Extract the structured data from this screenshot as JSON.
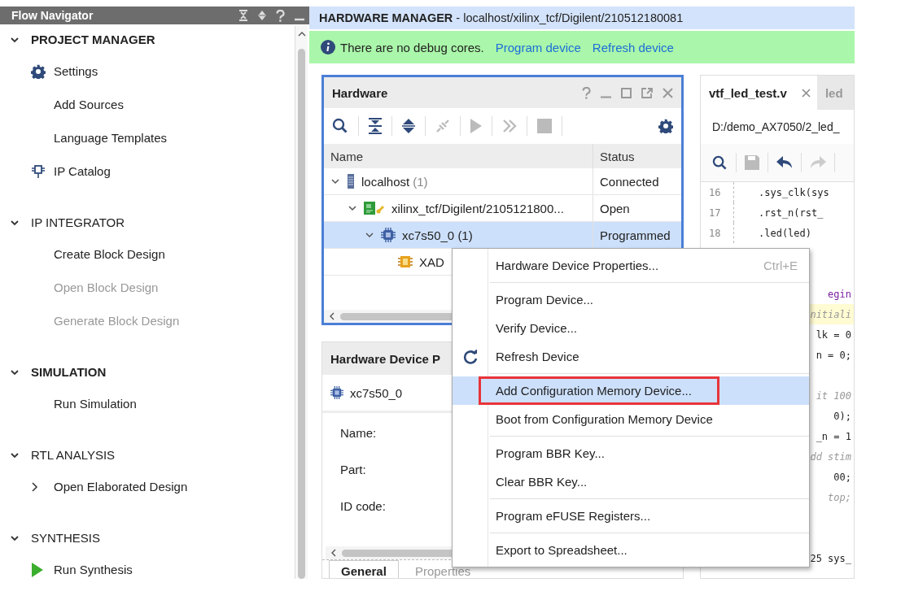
{
  "flow_navigator": {
    "title": "Flow Navigator",
    "sections": [
      {
        "title": "PROJECT MANAGER",
        "expanded": true,
        "emphasized": true,
        "items": [
          {
            "label": "Settings",
            "disabled": false
          },
          {
            "label": "Add Sources",
            "disabled": false
          },
          {
            "label": "Language Templates",
            "disabled": false
          },
          {
            "label": "IP Catalog",
            "disabled": false
          }
        ]
      },
      {
        "title": "IP INTEGRATOR",
        "expanded": true,
        "emphasized": false,
        "items": [
          {
            "label": "Create Block Design",
            "disabled": false
          },
          {
            "label": "Open Block Design",
            "disabled": true
          },
          {
            "label": "Generate Block Design",
            "disabled": true
          }
        ]
      },
      {
        "title": "SIMULATION",
        "expanded": true,
        "emphasized": true,
        "items": [
          {
            "label": "Run Simulation",
            "disabled": false
          }
        ]
      },
      {
        "title": "RTL ANALYSIS",
        "expanded": true,
        "emphasized": false,
        "items": [
          {
            "label": "Open Elaborated Design",
            "disabled": false
          }
        ]
      },
      {
        "title": "SYNTHESIS",
        "expanded": true,
        "emphasized": false,
        "items": [
          {
            "label": "Run Synthesis",
            "disabled": false
          }
        ]
      }
    ]
  },
  "hardware_manager": {
    "title": "HARDWARE MANAGER",
    "path": "- localhost/xilinx_tcf/Digilent/210512180081"
  },
  "banner": {
    "message": "There are no debug cores.",
    "links": [
      "Program device",
      "Refresh device"
    ]
  },
  "hardware_panel": {
    "title": "Hardware",
    "columns": [
      "Name",
      "Status"
    ],
    "tree": [
      {
        "name": "localhost",
        "count": "(1)",
        "status": "Connected",
        "expanded": true,
        "selected": false,
        "children": [
          {
            "name": "xilinx_tcf/Digilent/2105121800...",
            "status": "Open",
            "expanded": true,
            "selected": false,
            "children": [
              {
                "name": "xc7s50_0 (1)",
                "status": "Programmed",
                "expanded": true,
                "selected": true,
                "children": [
                  {
                    "name": "XAD",
                    "selected": false
                  }
                ]
              }
            ]
          }
        ]
      }
    ]
  },
  "properties_panel": {
    "title": "Hardware Device P",
    "device": "xc7s50_0",
    "fields": [
      "Name:",
      "Part:",
      "ID code:"
    ],
    "tabs": [
      {
        "label": "General",
        "selected": true
      },
      {
        "label": "Properties",
        "selected": false
      }
    ]
  },
  "editor": {
    "tabs": [
      {
        "label": "vtf_led_test.v",
        "selected": true
      },
      {
        "label": "led",
        "selected": false
      }
    ],
    "path": "D:/demo_AX7050/2_led_",
    "lines": [
      {
        "number": "16",
        "text": ".sys_clk(sys",
        "kind": "code",
        "highlight": false
      },
      {
        "number": "17",
        "text": ".rst_n(rst_",
        "kind": "code",
        "highlight": false
      },
      {
        "number": "18",
        "text": ".led(led)",
        "kind": "code",
        "highlight": false
      },
      {
        "kind": "blank"
      },
      {
        "kind": "blank"
      },
      {
        "text": "egin",
        "kind": "keyword",
        "highlight": false
      },
      {
        "text": "nitiali",
        "kind": "comment",
        "highlight": true
      },
      {
        "text": "lk = 0",
        "kind": "code",
        "highlight": false
      },
      {
        "text": "n = 0;",
        "kind": "code",
        "highlight": false
      },
      {
        "kind": "blank"
      },
      {
        "text": "it 100",
        "kind": "comment",
        "highlight": false
      },
      {
        "text": "0);",
        "kind": "code",
        "highlight": false
      },
      {
        "text": "_n = 1",
        "kind": "code",
        "highlight": false
      },
      {
        "text": "dd stim",
        "kind": "comment",
        "highlight": false
      },
      {
        "text": "00;",
        "kind": "code",
        "highlight": false
      },
      {
        "text": "top;",
        "kind": "comment",
        "highlight": false
      },
      {
        "kind": "blank"
      },
      {
        "kind": "blank"
      },
      {
        "text": "25 sys_",
        "kind": "code",
        "highlight": false
      }
    ]
  },
  "context_menu": {
    "groups": [
      [
        {
          "label": "Hardware Device Properties...",
          "shortcut": "Ctrl+E",
          "selected": false,
          "annotated": false
        }
      ],
      [
        {
          "label": "Program Device...",
          "selected": false,
          "annotated": false
        },
        {
          "label": "Verify Device...",
          "selected": false,
          "annotated": false
        },
        {
          "label": "Refresh Device",
          "selected": false,
          "annotated": false
        }
      ],
      [
        {
          "label": "Add Configuration Memory Device...",
          "selected": true,
          "annotated": true
        },
        {
          "label": "Boot from Configuration Memory Device",
          "selected": false,
          "annotated": false
        }
      ],
      [
        {
          "label": "Program BBR Key...",
          "selected": false,
          "annotated": false
        },
        {
          "label": "Clear BBR Key...",
          "selected": false,
          "annotated": false
        }
      ],
      [
        {
          "label": "Program eFUSE Registers...",
          "selected": false,
          "annotated": false
        }
      ],
      [
        {
          "label": "Export to Spreadsheet...",
          "selected": false,
          "annotated": false
        }
      ]
    ]
  }
}
